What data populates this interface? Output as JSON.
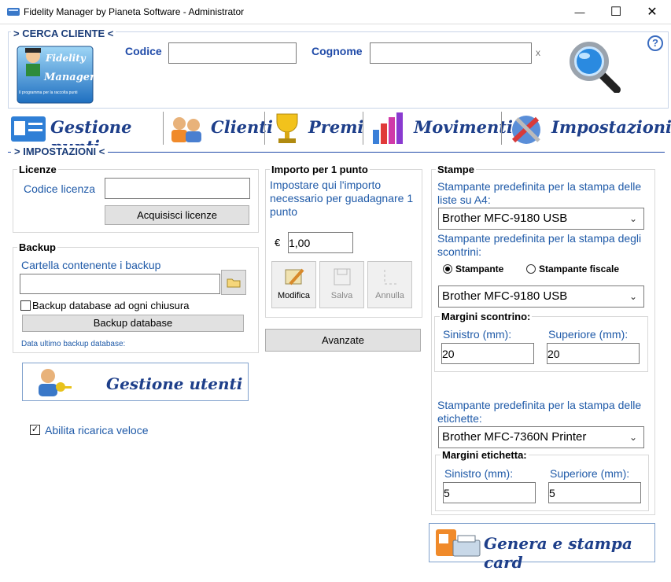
{
  "window": {
    "title": "Fidelity Manager by Pianeta Software - Administrator",
    "minimize": "—",
    "maximize": "☐",
    "close": "✕"
  },
  "search": {
    "heading": "> CERCA CLIENTE <",
    "codice_label": "Codice",
    "codice_value": "",
    "cognome_label": "Cognome",
    "cognome_value": "",
    "clear": "x",
    "help": "?",
    "logo_line1": "Fidelity",
    "logo_line2": "Manager",
    "logo_tag": "Il programma per la raccolta punti"
  },
  "nav": {
    "items": [
      {
        "label": "Gestione punti"
      },
      {
        "label": "Clienti"
      },
      {
        "label": "Premi"
      },
      {
        "label": "Movimenti"
      },
      {
        "label": "Impostazioni"
      }
    ]
  },
  "section": {
    "heading": "> IMPOSTAZIONI <"
  },
  "licenze": {
    "title": "Licenze",
    "codice_label": "Codice licenza",
    "codice_value": "",
    "acquire_button": "Acquisisci licenze"
  },
  "backup": {
    "title": "Backup",
    "folder_label": "Cartella contenente i backup",
    "folder_value": "",
    "checkbox_label": "Backup database ad ogni chiusura",
    "checkbox_checked": false,
    "backup_button": "Backup database",
    "last_label": "Data ultimo backup database:"
  },
  "gestione_utenti": {
    "label": "Gestione utenti"
  },
  "ricarica": {
    "label": "Abilita ricarica veloce",
    "checked": true
  },
  "importo": {
    "title": "Importo per 1 punto",
    "description": "Impostare qui l'importo necessario per guadagnare 1 punto",
    "currency": "€",
    "value": "1,00",
    "modifica": "Modifica",
    "salva": "Salva",
    "annulla": "Annulla"
  },
  "avanzate": {
    "label": "Avanzate"
  },
  "stampe": {
    "title": "Stampe",
    "a4_label": "Stampante predefinita per la stampa delle liste su A4:",
    "a4_value": "Brother MFC-9180 USB",
    "scontrini_label": "Stampante predefinita per la stampa degli scontrini:",
    "radio_stampante": "Stampante",
    "radio_fiscale": "Stampante fiscale",
    "scontrini_value": "Brother MFC-9180 USB",
    "margini_scontrino_title": "Margini scontrino:",
    "sinistro_label": "Sinistro (mm):",
    "superiore_label": "Superiore (mm):",
    "scontrino_sinistro": "20",
    "scontrino_superiore": "20",
    "etichette_label": "Stampante predefinita per la stampa delle etichette:",
    "etichette_value": "Brother MFC-7360N Printer",
    "margini_etichetta_title": "Margini etichetta:",
    "etichetta_sinistro": "5",
    "etichetta_superiore": "5"
  },
  "genera": {
    "label": "Genera e stampa card"
  },
  "colors": {
    "accent": "#1f5aa8",
    "nav_text": "#1e3f8a",
    "window_bg": "#ffffff"
  },
  "icons": [
    "app-icon",
    "search-magnifier-icon",
    "help-icon",
    "points-card-icon",
    "clients-icon",
    "trophy-icon",
    "chart-icon",
    "settings-tools-icon",
    "folder-icon",
    "pencil-icon",
    "save-icon",
    "undo-icon",
    "user-key-icon",
    "card-printer-icon"
  ]
}
